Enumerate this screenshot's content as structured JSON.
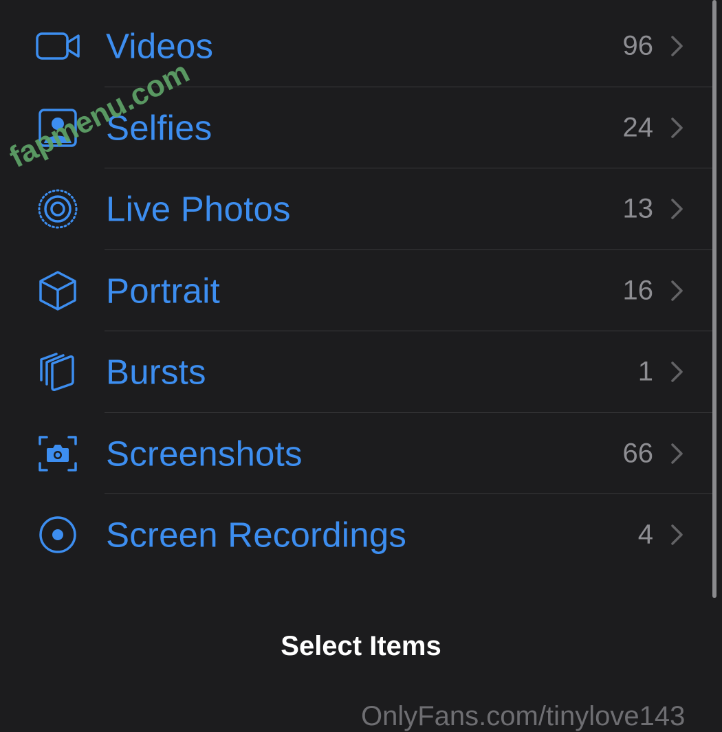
{
  "media_types": {
    "items": [
      {
        "label": "Videos",
        "count": "96",
        "icon": "video-camera-icon"
      },
      {
        "label": "Selfies",
        "count": "24",
        "icon": "portrait-photo-icon"
      },
      {
        "label": "Live Photos",
        "count": "13",
        "icon": "live-photo-icon"
      },
      {
        "label": "Portrait",
        "count": "16",
        "icon": "cube-icon"
      },
      {
        "label": "Bursts",
        "count": "1",
        "icon": "stacked-squares-icon"
      },
      {
        "label": "Screenshots",
        "count": "66",
        "icon": "screenshot-camera-icon"
      },
      {
        "label": "Screen Recordings",
        "count": "4",
        "icon": "record-circle-icon"
      }
    ]
  },
  "footer": {
    "select_items_label": "Select Items"
  },
  "watermarks": {
    "top": "fapmenu.com",
    "bottom": "OnlyFans.com/tinylove143"
  },
  "colors": {
    "background": "#1c1c1e",
    "accent": "#3d8ef0",
    "secondary_text": "#8e8e93",
    "separator": "#3a3a3c",
    "watermark_green": "#5fa368"
  }
}
